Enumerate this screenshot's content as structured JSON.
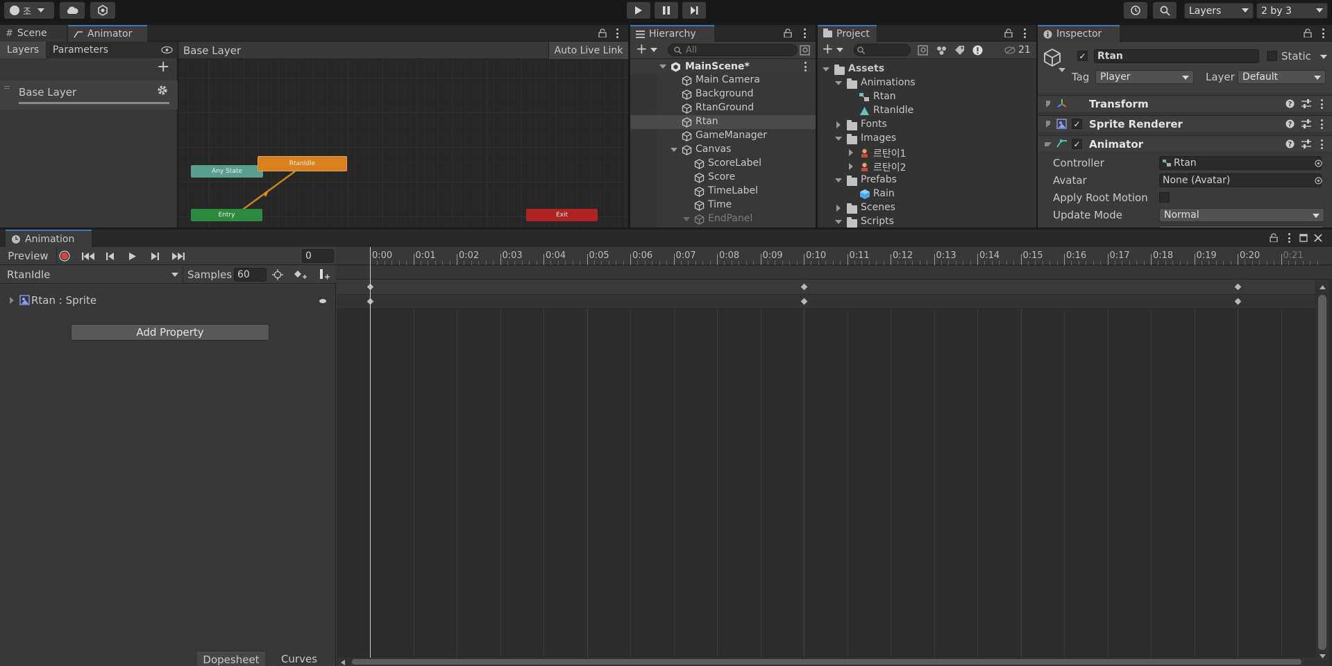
{
  "toolbar": {
    "account_label": "조",
    "layers_label": "Layers",
    "layout_label": "2 by 3"
  },
  "animator": {
    "tabs": [
      "Scene",
      "Animator"
    ],
    "subtabs": [
      "Layers",
      "Parameters"
    ],
    "breadcrumb": "Base Layer",
    "live_link": "Auto Live Link",
    "layer_item": "Base Layer",
    "nodes": {
      "any_state": "Any State",
      "idle": "RtanIdle",
      "entry": "Entry",
      "exit": "Exit"
    }
  },
  "hierarchy": {
    "tab": "Hierarchy",
    "search_placeholder": "All",
    "scene": "MainScene*",
    "items": [
      "Main Camera",
      "Background",
      "RtanGround",
      "Rtan",
      "GameManager",
      "Canvas",
      "ScoreLabel",
      "Score",
      "TimeLabel",
      "Time",
      "EndPanel"
    ]
  },
  "project": {
    "tab": "Project",
    "hidden_count": "21",
    "tree": [
      "Assets",
      "Animations",
      "Rtan",
      "RtanIdle",
      "Fonts",
      "Images",
      "르탄이1",
      "르탄이2",
      "Prefabs",
      "Rain",
      "Scenes",
      "Scripts"
    ]
  },
  "inspector": {
    "tab": "Inspector",
    "object_name": "Rtan",
    "static_label": "Static",
    "tag_label": "Tag",
    "tag_value": "Player",
    "layer_label": "Layer",
    "layer_value": "Default",
    "components": [
      "Transform",
      "Sprite Renderer",
      "Animator"
    ],
    "props": {
      "controller_label": "Controller",
      "controller_value": "Rtan",
      "avatar_label": "Avatar",
      "avatar_value": "None (Avatar)",
      "root_motion_label": "Apply Root Motion",
      "update_label": "Update Mode",
      "update_value": "Normal"
    }
  },
  "animation": {
    "tab": "Animation",
    "preview": "Preview",
    "frame": "0",
    "clip": "RtanIdle",
    "samples_label": "Samples",
    "samples_value": "60",
    "property": "Rtan : Sprite",
    "add_property": "Add Property",
    "dopesheet": "Dopesheet",
    "curves": "Curves",
    "ticks": [
      "0:00",
      "0:01",
      "0:02",
      "0:03",
      "0:04",
      "0:05",
      "0:06",
      "0:07",
      "0:08",
      "0:09",
      "0:10",
      "0:11",
      "0:12",
      "0:13",
      "0:14",
      "0:15",
      "0:16",
      "0:17",
      "0:18",
      "0:19",
      "0:20",
      "0:21"
    ],
    "keyframes": [
      0,
      10,
      20
    ]
  },
  "colors": {
    "accent": "#3a79bb",
    "any_state": "#5a9e8f",
    "entry": "#2b8a3e",
    "exit": "#b02323",
    "state": "#d9801f",
    "record": "#e0413a"
  }
}
